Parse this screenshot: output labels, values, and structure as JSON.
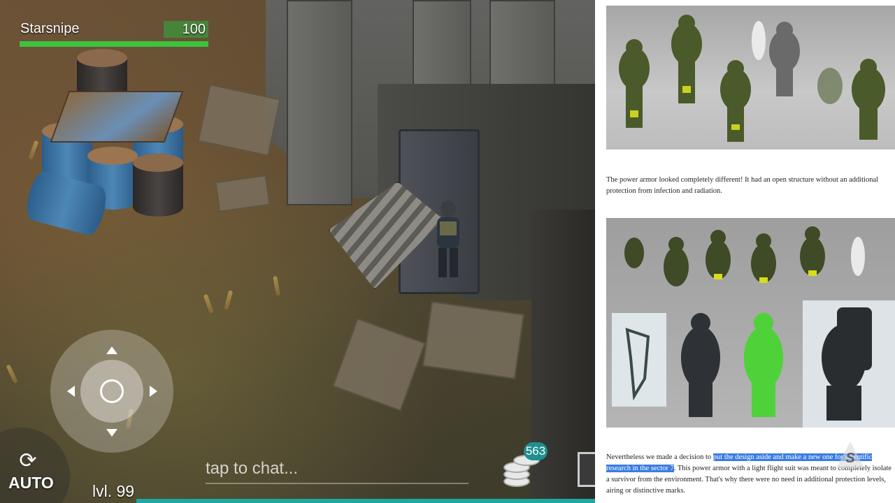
{
  "game": {
    "player_name": "Starsnipe",
    "health_value": "100",
    "health_fraction": 1.0,
    "auto_label": "AUTO",
    "level_label": "lvl. 99",
    "chat_placeholder": "tap to chat...",
    "coins_count": "563"
  },
  "article": {
    "paragraph1": "The power armor looked completely different! It had an open structure without an additional protection from infection and radiation.",
    "paragraph2_before": "Nevertheless we made a decision to ",
    "paragraph2_highlight": "put the design aside and make a new one for scientific research in the sector 7",
    "paragraph2_after": ". This power armor with a light flight suit was meant to completely isolate a survivor from the environment. That's why there were no need in additional protection levels, airing or distinctive marks."
  },
  "colors": {
    "health_fill": "#3dc23d",
    "accent_teal": "#1f8f8f",
    "highlight": "#3b7de0"
  }
}
